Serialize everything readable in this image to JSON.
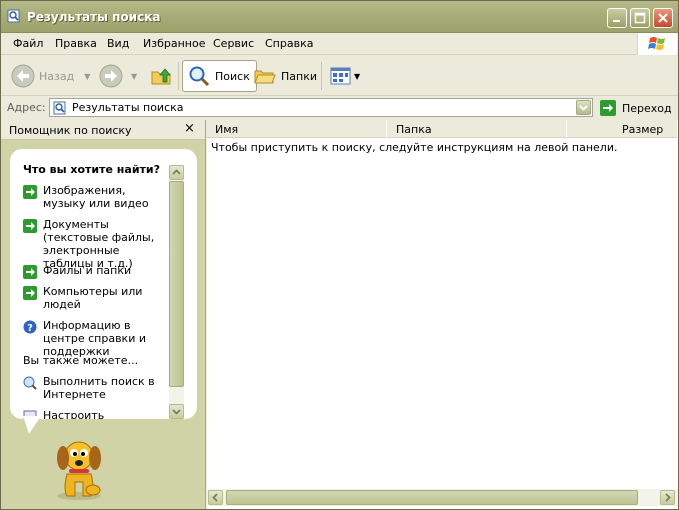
{
  "window": {
    "title": "Результаты поиска"
  },
  "menu": {
    "items": [
      "Файл",
      "Правка",
      "Вид",
      "Избранное",
      "Сервис",
      "Справка"
    ]
  },
  "toolbar": {
    "back_label": "Назад",
    "search_label": "Поиск",
    "folders_label": "Папки"
  },
  "address": {
    "label": "Адрес:",
    "value": "Результаты поиска",
    "go_label": "Переход"
  },
  "left_pane": {
    "header": "Помощник по поиску",
    "question": "Что вы хотите найти?",
    "options": [
      "Изображения, музыку или видео",
      "Документы (текстовые файлы, электронные таблицы и т.д.)",
      "Файлы и папки",
      "Компьютеры или людей",
      "Информацию в центре справки и поддержки"
    ],
    "also_label": "Вы также можете...",
    "also_options": [
      "Выполнить поиск в Интернете",
      "Настроить помощника"
    ]
  },
  "results": {
    "columns": [
      "Имя",
      "Папка",
      "Размер"
    ],
    "hint": "Чтобы приступить к поиску, следуйте инструкциям на левой панели."
  },
  "colors": {
    "title_bar": "#a8ad78",
    "pane_bg": "#cfd3a5",
    "go_arrow": "#2e9b32",
    "close_button": "#c8462b"
  }
}
